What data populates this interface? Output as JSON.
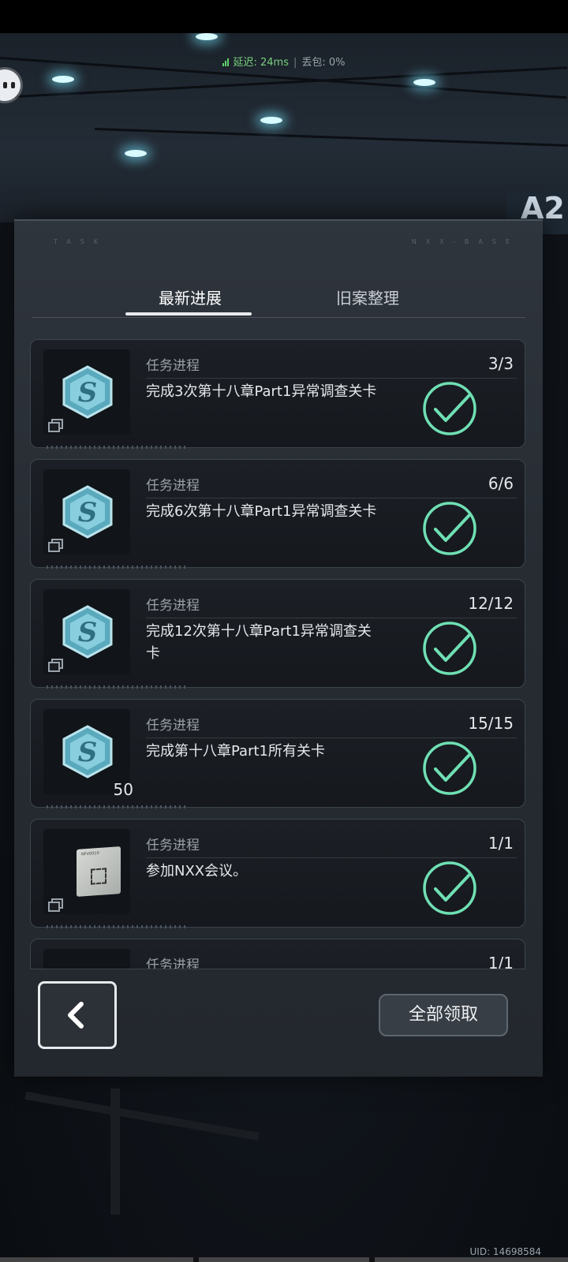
{
  "status": {
    "latency_label": "延迟: 24ms",
    "loss_label": "丢包: 0%"
  },
  "scene": {
    "sign_text": "A2"
  },
  "panel": {
    "header_left": "TASK",
    "header_right": "NXX-BASE",
    "tabs": [
      {
        "label": "最新进展",
        "active": true
      },
      {
        "label": "旧案整理",
        "active": false
      }
    ]
  },
  "tasks": [
    {
      "label": "任务进程",
      "desc": "完成3次第十八章Part1异常调查关卡",
      "count": "3/3",
      "icon": "hexagon-s-badge-icon",
      "quantity": "",
      "completed": true
    },
    {
      "label": "任务进程",
      "desc": "完成6次第十八章Part1异常调查关卡",
      "count": "6/6",
      "icon": "hexagon-s-badge-icon",
      "quantity": "",
      "completed": true
    },
    {
      "label": "任务进程",
      "desc": "完成12次第十八章Part1异常调查关卡",
      "count": "12/12",
      "icon": "hexagon-s-badge-icon",
      "quantity": "",
      "completed": true
    },
    {
      "label": "任务进程",
      "desc": "完成第十八章Part1所有关卡",
      "count": "15/15",
      "icon": "hexagon-s-badge-icon",
      "quantity": "50",
      "completed": true
    },
    {
      "label": "任务进程",
      "desc": "参加NXX会议。",
      "count": "1/1",
      "icon": "chip-card-icon",
      "quantity": "",
      "completed": true
    },
    {
      "label": "任务进程",
      "desc": "",
      "count": "1/1",
      "icon": "chip-card-icon",
      "quantity": "",
      "completed": true
    }
  ],
  "footer": {
    "claim_all_label": "全部领取"
  },
  "uid_label": "UID: 14698584",
  "colors": {
    "check_accent": "#6fe0b4",
    "panel_bg": "#2a2f36",
    "hex_badge": "#7fc3d3"
  }
}
